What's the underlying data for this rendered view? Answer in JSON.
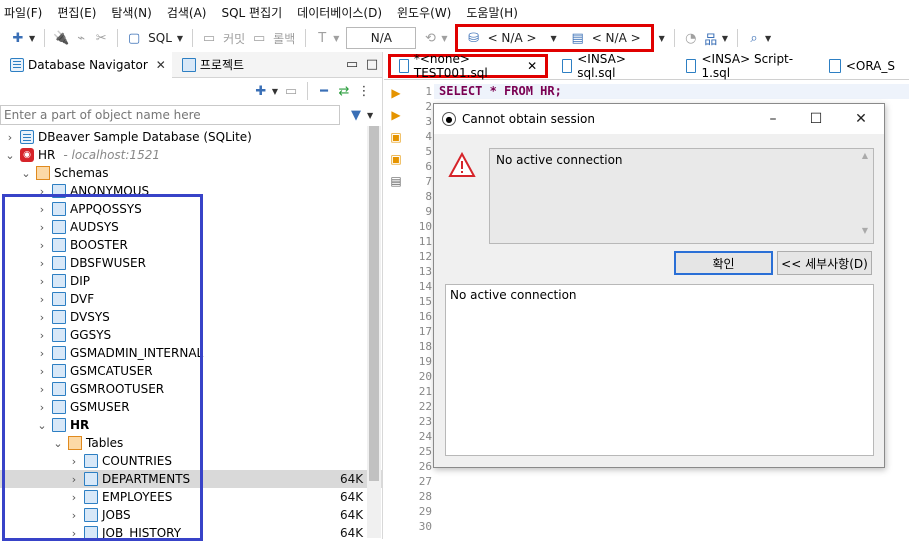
{
  "menu": [
    "파일(F)",
    "편집(E)",
    "탐색(N)",
    "검색(A)",
    "SQL 편집기",
    "데이터베이스(D)",
    "윈도우(W)",
    "도움말(H)"
  ],
  "toolbar": {
    "sql_label": "SQL",
    "commit_label": "커밋",
    "rollback_label": "롤백",
    "tx_value": "N/A",
    "datasource_selector": "< N/A >",
    "schema_selector": "< N/A >"
  },
  "left_tabs": {
    "navigator": "Database Navigator",
    "project": "프로젝트"
  },
  "filter_placeholder": "Enter a part of object name here",
  "tree": {
    "sample_db": "DBeaver Sample Database (SQLite)",
    "hr_conn": "HR",
    "hr_host": "- localhost:1521",
    "schemas_label": "Schemas",
    "schemas": [
      "ANONYMOUS",
      "APPQOSSYS",
      "AUDSYS",
      "BOOSTER",
      "DBSFWUSER",
      "DIP",
      "DVF",
      "DVSYS",
      "GGSYS",
      "GSMADMIN_INTERNAL",
      "GSMCATUSER",
      "GSMROOTUSER",
      "GSMUSER"
    ],
    "hr_schema": "HR",
    "tables_label": "Tables",
    "tables": [
      {
        "name": "COUNTRIES",
        "size": ""
      },
      {
        "name": "DEPARTMENTS",
        "size": "64K"
      },
      {
        "name": "EMPLOYEES",
        "size": "64K"
      },
      {
        "name": "JOBS",
        "size": "64K"
      },
      {
        "name": "JOB_HISTORY",
        "size": "64K"
      }
    ]
  },
  "editor_tabs": [
    "*<none> TEST001.sql",
    "<INSA> sql.sql",
    "<INSA> Script-1.sql",
    "<ORA_S"
  ],
  "code_line": "SELECT * FROM HR;",
  "line_numbers": [
    "1",
    "2",
    "3",
    "4",
    "5",
    "6",
    "7",
    "8",
    "9",
    "10",
    "11",
    "12",
    "13",
    "14",
    "15",
    "16",
    "17",
    "18",
    "19",
    "20",
    "21",
    "22",
    "23",
    "24",
    "25",
    "26",
    "27",
    "28",
    "29",
    "30"
  ],
  "dialog": {
    "title": "Cannot obtain session",
    "message": "No active connection",
    "ok_label": "확인",
    "details_label": "<< 세부사항(D)",
    "details_text": "No active connection"
  }
}
